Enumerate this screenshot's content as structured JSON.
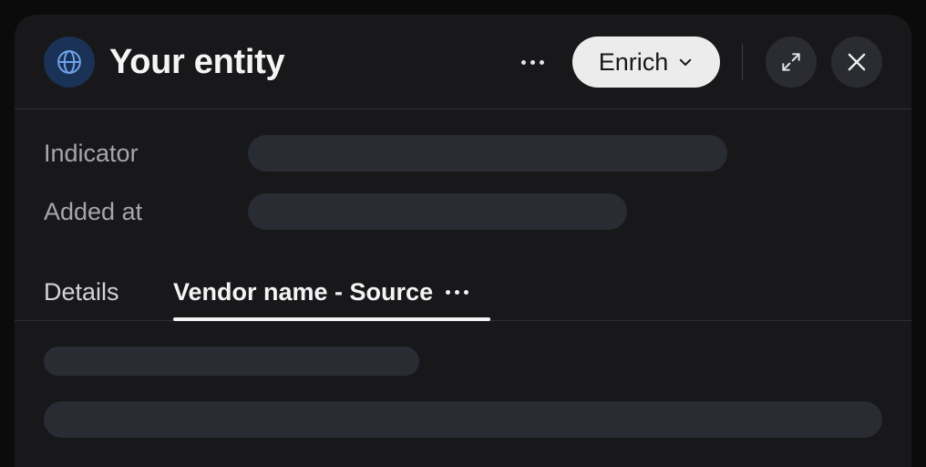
{
  "header": {
    "title": "Your entity",
    "enrich_label": "Enrich",
    "icon": "globe-icon"
  },
  "fields": [
    {
      "label": "Indicator"
    },
    {
      "label": "Added at"
    }
  ],
  "tabs": [
    {
      "label": "Details",
      "active": false
    },
    {
      "label": "Vendor name - Source",
      "active": true
    }
  ],
  "colors": {
    "panel_bg": "#18181b",
    "skeleton": "#2a2c33",
    "globe_bg": "#1a3255",
    "globe_stroke": "#6fa3ec",
    "enrich_bg": "#ececed"
  }
}
